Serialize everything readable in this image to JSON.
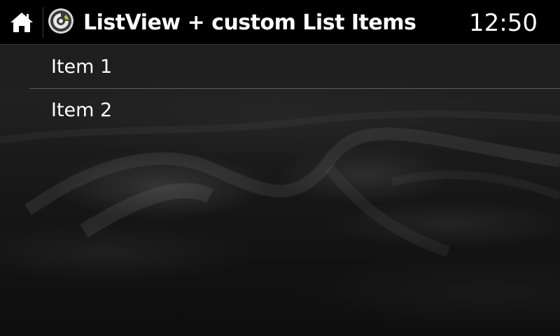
{
  "header": {
    "title": "ListView + custom List Items",
    "clock": "12:50",
    "home_icon": "home-icon",
    "app_icon": "app-logo-icon"
  },
  "list": {
    "items": [
      {
        "label": "Item 1"
      },
      {
        "label": "Item 2"
      }
    ]
  },
  "colors": {
    "titlebar_bg": "#000000",
    "app_icon_accent": "#9ACD32",
    "text": "#ffffff"
  }
}
